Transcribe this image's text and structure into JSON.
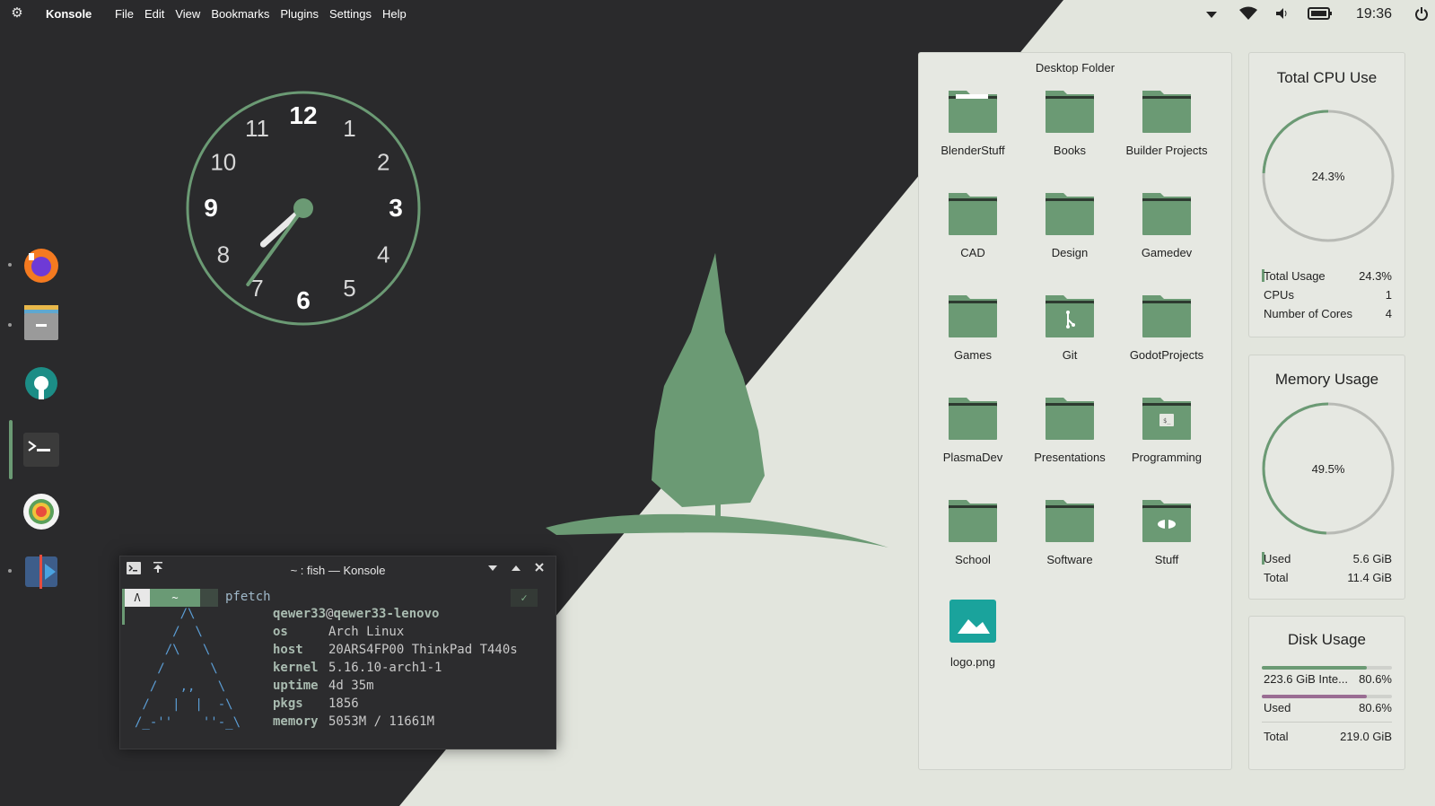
{
  "topbar": {
    "app_name": "Konsole",
    "menu": [
      "File",
      "Edit",
      "View",
      "Bookmarks",
      "Plugins",
      "Settings",
      "Help"
    ],
    "time": "19:36",
    "icons": [
      "kde-logo-icon",
      "chevron-down-icon",
      "wifi-icon",
      "volume-icon",
      "battery-icon",
      "power-icon"
    ]
  },
  "dock": {
    "items": [
      "firefox",
      "dolphin-file-manager",
      "system-settings",
      "konsole",
      "color-app",
      "media-player"
    ],
    "active": "konsole"
  },
  "konsole": {
    "title": "~ : fish — Konsole",
    "prompt_tilde": "~",
    "prompt_cmd": "pfetch",
    "check": "✓",
    "ascii": "      /\\\n     /  \\\n    /\\   \\\n   /      \\\n  /   ,,   \\\n /   |  |  -\\\n/_-''    ''-_\\",
    "user": "qewer33",
    "at": "@",
    "host": "qewer33-lenovo",
    "info": [
      {
        "key": "os",
        "value": "Arch Linux"
      },
      {
        "key": "host",
        "value": "20ARS4FP00 ThinkPad T440s"
      },
      {
        "key": "kernel",
        "value": "5.16.10-arch1-1"
      },
      {
        "key": "uptime",
        "value": "4d 35m"
      },
      {
        "key": "pkgs",
        "value": "1856"
      },
      {
        "key": "memory",
        "value": "5053M / 11661M"
      }
    ]
  },
  "desktop_folder": {
    "title": "Desktop Folder",
    "items": [
      {
        "label": "BlenderStuff",
        "icon": "folder"
      },
      {
        "label": "Books",
        "icon": "folder"
      },
      {
        "label": "Builder Projects",
        "icon": "folder"
      },
      {
        "label": "CAD",
        "icon": "folder"
      },
      {
        "label": "Design",
        "icon": "folder"
      },
      {
        "label": "Gamedev",
        "icon": "folder"
      },
      {
        "label": "Games",
        "icon": "folder"
      },
      {
        "label": "Git",
        "icon": "folder-git"
      },
      {
        "label": "GodotProjects",
        "icon": "folder"
      },
      {
        "label": "PlasmaDev",
        "icon": "folder"
      },
      {
        "label": "Presentations",
        "icon": "folder"
      },
      {
        "label": "Programming",
        "icon": "folder-script"
      },
      {
        "label": "School",
        "icon": "folder"
      },
      {
        "label": "Software",
        "icon": "folder"
      },
      {
        "label": "Stuff",
        "icon": "folder-other"
      },
      {
        "label": "logo.png",
        "icon": "image"
      }
    ]
  },
  "cpu": {
    "title": "Total CPU Use",
    "center": "24.3%",
    "fraction": 0.243,
    "rows": [
      {
        "label": "Total Usage",
        "value": "24.3%"
      },
      {
        "label": "CPUs",
        "value": "1"
      },
      {
        "label": "Number of Cores",
        "value": "4"
      }
    ]
  },
  "memory": {
    "title": "Memory Usage",
    "center": "49.5%",
    "fraction": 0.495,
    "rows": [
      {
        "label": "Used",
        "value": "5.6 GiB"
      },
      {
        "label": "Total",
        "value": "11.4 GiB"
      }
    ]
  },
  "disk": {
    "title": "Disk Usage",
    "rows": [
      {
        "label": "223.6 GiB Inte...",
        "value": "80.6%",
        "fraction": 0.806
      },
      {
        "label": "Used",
        "value": "80.6%",
        "fraction": 0.806
      },
      {
        "label": "Total",
        "value": "219.0 GiB"
      }
    ]
  },
  "analog_clock": {
    "numbers": [
      "12",
      "1",
      "2",
      "3",
      "4",
      "5",
      "6",
      "7",
      "8",
      "9",
      "10",
      "11"
    ],
    "hour": 7,
    "minute": 36
  },
  "colors": {
    "accent": "#6b9a74",
    "dark_bg": "#2a2a2c",
    "light_bg": "#e2e5dd",
    "purple": "#9a6d93"
  }
}
